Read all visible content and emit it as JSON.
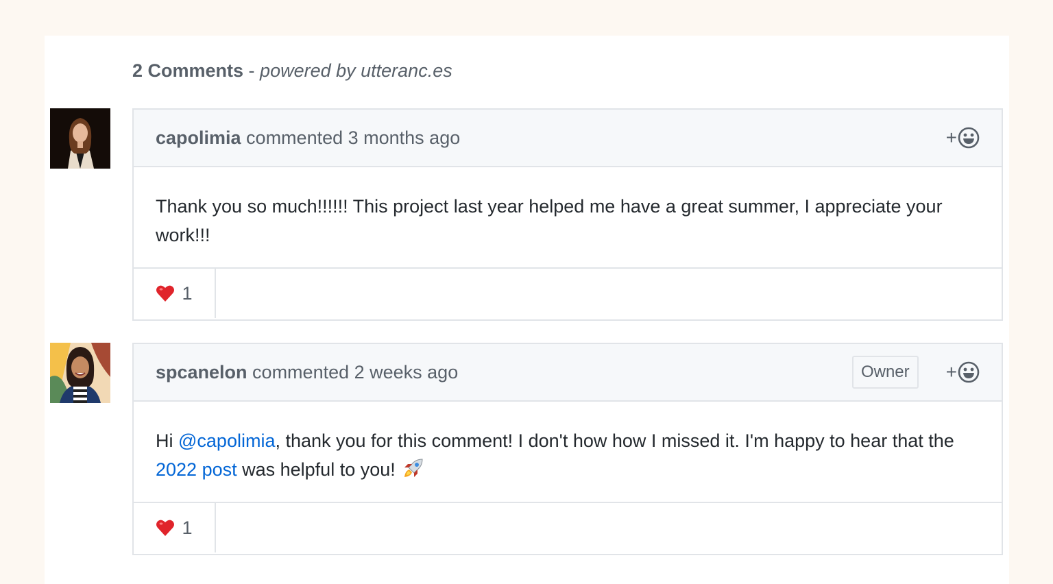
{
  "header": {
    "count_label": "2 Comments",
    "separator": " - ",
    "powered_prefix": "powered by ",
    "powered_link": "utteranc.es"
  },
  "colors": {
    "page_bg": "#fdf8f2",
    "link": "#0366d6",
    "muted": "#586069",
    "border": "#e1e4e8",
    "header_bg": "#f6f8fa"
  },
  "comments": [
    {
      "author": "capolimia",
      "meta": " commented 3 months ago",
      "badge": "",
      "body": "Thank you so much!!!!!! This project last year helped me have a great summer, I appreciate your work!!!",
      "reaction": {
        "emoji": "heart-icon",
        "count": "1"
      },
      "add_reaction_label": "+"
    },
    {
      "author": "spcanelon",
      "meta": " commented 2 weeks ago",
      "badge": "Owner",
      "body_parts": {
        "p1": "Hi ",
        "mention": "@capolimia",
        "p2": ", thank you for this comment! I don't how how I missed it. I'm happy to hear that the ",
        "link": "2022 post",
        "p3": " was helpful to you! "
      },
      "reaction": {
        "emoji": "heart-icon",
        "count": "1"
      },
      "add_reaction_label": "+"
    }
  ]
}
